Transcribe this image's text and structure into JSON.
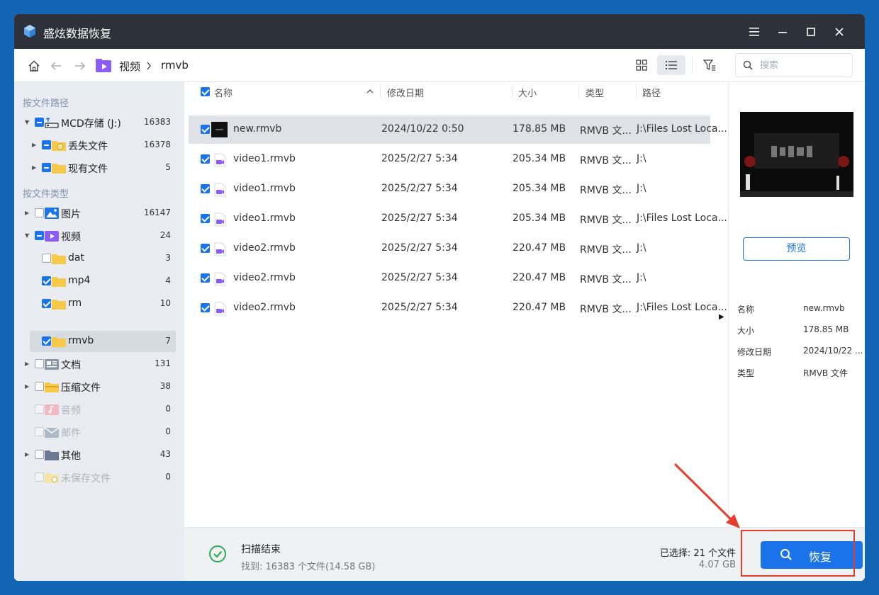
{
  "app": {
    "title": "盛炫数据恢复"
  },
  "toolbar": {
    "breadcrumb": [
      "视频",
      "rmvb"
    ],
    "search_placeholder": "搜索"
  },
  "sidebar": {
    "heading_path": "按文件路径",
    "heading_type": "按文件类型",
    "path_items": [
      {
        "label": "MCD存储 (J:)",
        "count": "16383"
      },
      {
        "label": "丢失文件",
        "count": "16378"
      },
      {
        "label": "现有文件",
        "count": "5"
      }
    ],
    "type_items": [
      {
        "label": "图片",
        "count": "16147"
      },
      {
        "label": "视频",
        "count": "24"
      },
      {
        "label": "dat",
        "count": "3"
      },
      {
        "label": "mp4",
        "count": "4"
      },
      {
        "label": "rm",
        "count": "10"
      },
      {
        "label": "rmvb",
        "count": "7"
      },
      {
        "label": "文档",
        "count": "131"
      },
      {
        "label": "压缩文件",
        "count": "38"
      },
      {
        "label": "音频",
        "count": "0"
      },
      {
        "label": "邮件",
        "count": "0"
      },
      {
        "label": "其他",
        "count": "43"
      },
      {
        "label": "未保存文件",
        "count": "0"
      }
    ]
  },
  "table": {
    "columns": [
      "名称",
      "修改日期",
      "大小",
      "类型",
      "路径"
    ],
    "rows": [
      {
        "name": "new.rmvb",
        "date": "2024/10/22 0:50",
        "size": "178.85 MB",
        "type": "RMVB 文...",
        "path": "J:\\Files Lost Loca..."
      },
      {
        "name": "video1.rmvb",
        "date": "2025/2/27 5:34",
        "size": "205.34 MB",
        "type": "RMVB 文...",
        "path": "J:\\"
      },
      {
        "name": "video1.rmvb",
        "date": "2025/2/27 5:34",
        "size": "205.34 MB",
        "type": "RMVB 文...",
        "path": "J:\\"
      },
      {
        "name": "video1.rmvb",
        "date": "2025/2/27 5:34",
        "size": "205.34 MB",
        "type": "RMVB 文...",
        "path": "J:\\Files Lost Loca..."
      },
      {
        "name": "video2.rmvb",
        "date": "2025/2/27 5:34",
        "size": "220.47 MB",
        "type": "RMVB 文...",
        "path": "J:\\"
      },
      {
        "name": "video2.rmvb",
        "date": "2025/2/27 5:34",
        "size": "220.47 MB",
        "type": "RMVB 文...",
        "path": "J:\\"
      },
      {
        "name": "video2.rmvb",
        "date": "2025/2/27 5:34",
        "size": "220.47 MB",
        "type": "RMVB 文...",
        "path": "J:\\Files Lost Loca..."
      }
    ]
  },
  "preview": {
    "button_label": "预览",
    "meta": [
      {
        "label": "名称",
        "value": "new.rmvb"
      },
      {
        "label": "大小",
        "value": "178.85 MB"
      },
      {
        "label": "修改日期",
        "value": "2024/10/22 ..."
      },
      {
        "label": "类型",
        "value": "RMVB 文件"
      }
    ]
  },
  "footer": {
    "scan_title": "扫描结束",
    "scan_sub": "找到: 16383 个文件(14.58 GB)",
    "selected_count": "已选择: 21 个文件",
    "selected_size": "4.07 GB",
    "recover_label": "恢复"
  },
  "colors": {
    "accent": "#1a73e8",
    "titlebar": "#2d3139",
    "annotation": "#e53e2f"
  }
}
